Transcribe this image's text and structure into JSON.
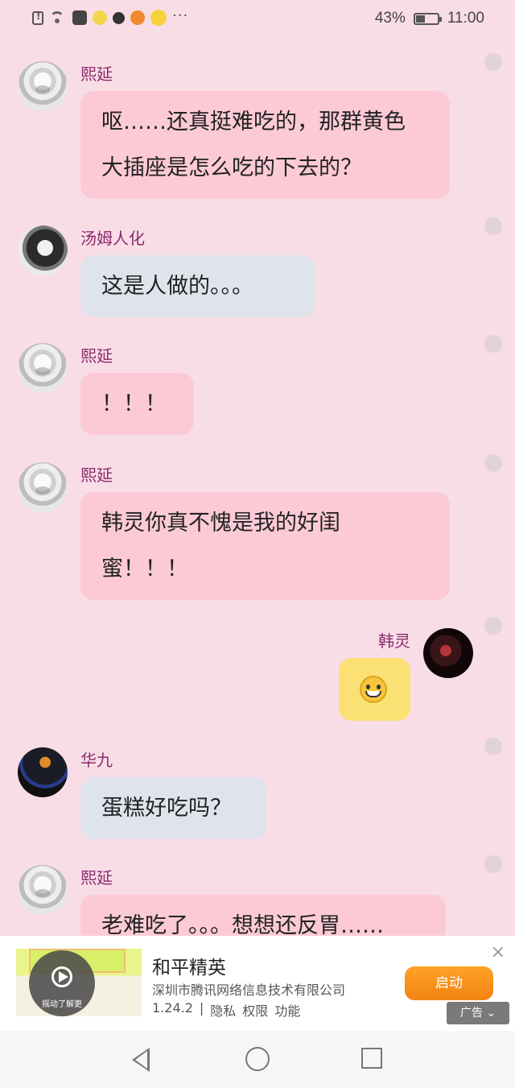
{
  "status_bar": {
    "battery": "43%",
    "time": "11:00",
    "notification_icons": [
      "alert-icon",
      "wifi-icon",
      "soul-app-icon",
      "chick-app-icon",
      "paw-app-icon",
      "game-app-icon",
      "note-app-icon"
    ],
    "more": "···"
  },
  "messages": [
    {
      "sender": "熙延",
      "side": "left",
      "lines": [
        "呕……还真挺难吃的，那群黄色",
        "大插座是怎么吃的下去的？"
      ],
      "bubble_color": "#fccad6"
    },
    {
      "sender": "汤姆人化",
      "side": "left",
      "lines": [
        "这是人做的。。。"
      ],
      "bubble_color": "#dfe3ec"
    },
    {
      "sender": "熙延",
      "side": "left",
      "lines": [
        "！！！"
      ],
      "bubble_color": "#fccad6"
    },
    {
      "sender": "熙延",
      "side": "left",
      "lines": [
        "韩灵你真不愧是我的好闺",
        "蜜！！！"
      ],
      "bubble_color": "#fccad6"
    },
    {
      "sender": "韩灵",
      "side": "right",
      "emoji": "grinning-face",
      "bubble_color": "#fbe074"
    },
    {
      "sender": "华九",
      "side": "left",
      "lines": [
        "蛋糕好吃吗？"
      ],
      "bubble_color": "#dfe3ec"
    },
    {
      "sender": "熙延",
      "side": "left",
      "lines": [
        "老难吃了。。。想想还反胃……"
      ],
      "bubble_color": "#fccad6"
    }
  ],
  "ad": {
    "title": "和平精英",
    "company": "深圳市腾讯网络信息技术有限公司",
    "version": "1.24.2",
    "links": [
      "隐私",
      "权限",
      "功能"
    ],
    "separator": "|",
    "button": "启动",
    "close": "×",
    "tag": "广告",
    "thumb_label": "摇动了解更"
  },
  "nav": {
    "back": "back",
    "home": "home",
    "recent": "recent"
  }
}
